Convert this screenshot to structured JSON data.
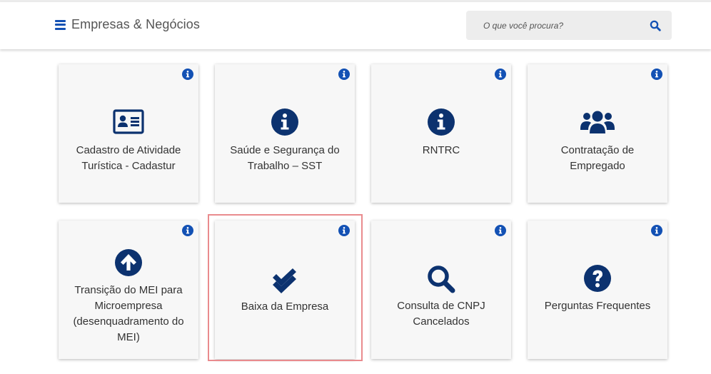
{
  "header": {
    "site_title": "Empresas & Negócios",
    "search_placeholder": "O que você procura?",
    "brand_color": "#1351b4"
  },
  "cards": [
    {
      "label": "Cadastro de Atividade Turística - Cadastur",
      "icon": "id-card-icon"
    },
    {
      "label": "Saúde e Segurança do Trabalho – SST",
      "icon": "info-circle-icon"
    },
    {
      "label": "RNTRC",
      "icon": "info-circle-icon"
    },
    {
      "label": "Contratação de Empregado",
      "icon": "users-icon"
    },
    {
      "label": "Transição do MEI para Microempresa (desenquadramento do MEI)",
      "icon": "arrow-circle-up-icon"
    },
    {
      "label": "Baixa da Empresa",
      "icon": "double-check-icon",
      "highlighted": true
    },
    {
      "label": "Consulta de CNPJ Cancelados",
      "icon": "search-icon"
    },
    {
      "label": "Perguntas Frequentes",
      "icon": "question-circle-icon"
    }
  ],
  "colors": {
    "icon": "#0c326f",
    "info_badge": "#1351b4",
    "highlight_border": "#e98b8e"
  }
}
